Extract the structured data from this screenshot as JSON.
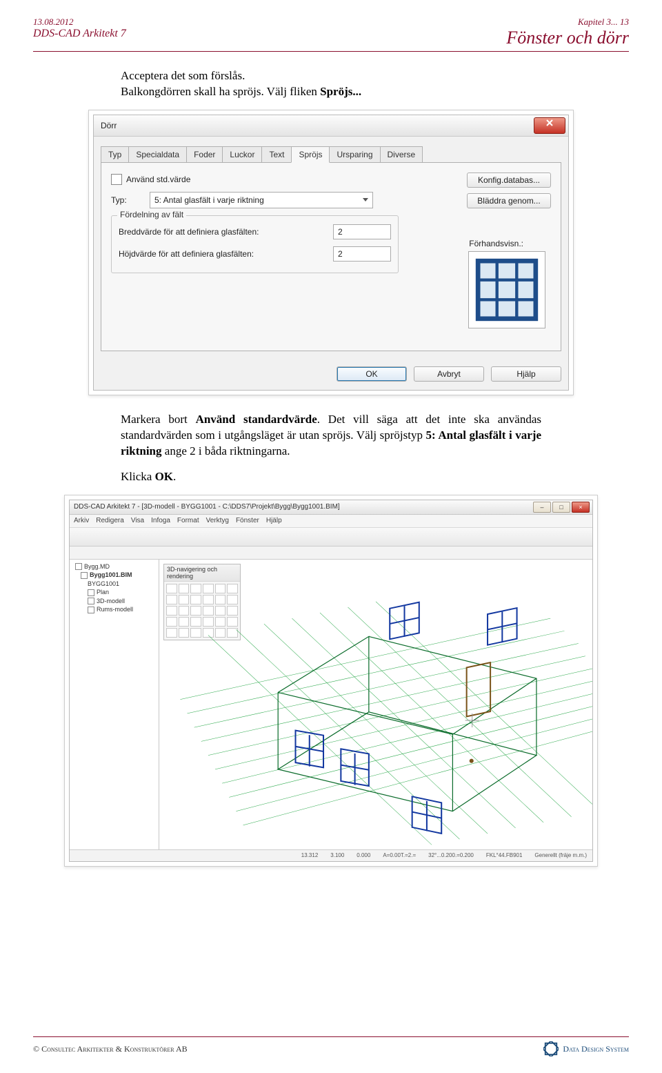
{
  "header": {
    "date": "13.08.2012",
    "product": "DDS-CAD Arkitekt 7",
    "chapter": "Kapitel 3... 13",
    "section_title": "Fönster och dörr"
  },
  "para1": {
    "s1": "Acceptera det som förslås.",
    "s2": "Balkongdörren skall ha spröjs. Välj fliken ",
    "s2b": "Spröjs...",
    "s3": ""
  },
  "dialog": {
    "title": "Dörr",
    "tabs": [
      "Typ",
      "Specialdata",
      "Foder",
      "Luckor",
      "Text",
      "Spröjs",
      "Ursparing",
      "Diverse"
    ],
    "active_tab": 5,
    "use_std_label": "Använd std.värde",
    "type_label": "Typ:",
    "type_value": "5: Antal glasfält i varje riktning",
    "config_btn": "Konfig.databas...",
    "browse_btn": "Bläddra genom...",
    "group_legend": "Fördelning av fält",
    "width_label": "Breddvärde för att definiera glasfälten:",
    "width_value": "2",
    "height_label": "Höjdvärde för att definiera glasfälten:",
    "height_value": "2",
    "preview_label": "Förhandsvisn.:",
    "ok": "OK",
    "cancel": "Avbryt",
    "help": "Hjälp"
  },
  "para2": {
    "s1_a": "Markera bort ",
    "s1_b": "Använd standardvärde",
    "s1_c": ". Det vill säga att det inte ska användas standardvärden som i utgångsläget är utan spröjs. Välj spröjstyp ",
    "s1_d": "5: Antal glasfält i varje riktning",
    "s1_e": " ange 2 i båda riktningarna.",
    "s2": "Klicka ",
    "s2b": "OK",
    "s2c": "."
  },
  "appwin": {
    "title": "DDS-CAD Arkitekt 7 - [3D-modell - BYGG1001 - C:\\DDS7\\Projekt\\Bygg\\Bygg1001.BIM]",
    "menus": [
      "Arkiv",
      "Redigera",
      "Visa",
      "Infoga",
      "Format",
      "Verktyg",
      "Fönster",
      "Hjälp"
    ],
    "tree": {
      "root": "Bygg.MD",
      "nodes": [
        "Bygg1001.BIM",
        "BYGG1001",
        "Plan",
        "3D-modell",
        "Rums-modell"
      ]
    },
    "palette_title": "3D-navigering och rendering",
    "status": [
      "13.312",
      "3.100",
      "0.000",
      "A=0.00T.=2.=",
      "32°...0.200.=0.200",
      "FKL°44.FB901",
      "Generellt (fräje m.m.)"
    ]
  },
  "footer": {
    "copyright": "©  Consultec Arkitekter & Konstruktörer AB",
    "brand": "Data Design System"
  }
}
